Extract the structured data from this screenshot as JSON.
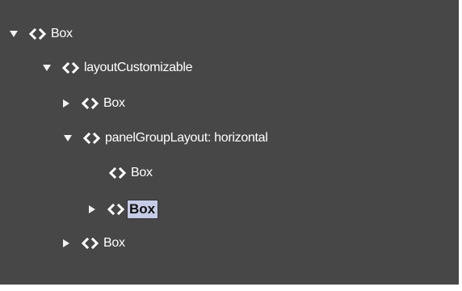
{
  "tree": {
    "nodes": [
      {
        "label": "Box",
        "toggle": "expanded",
        "icon": "tag-icon"
      },
      {
        "label": "layoutCustomizable",
        "toggle": "expanded",
        "icon": "tag-icon"
      },
      {
        "label": "Box",
        "toggle": "collapsed",
        "icon": "tag-icon"
      },
      {
        "label": "panelGroupLayout: horizontal",
        "toggle": "expanded",
        "icon": "tag-icon"
      },
      {
        "label": "Box",
        "toggle": "none",
        "icon": "tag-icon"
      },
      {
        "label": "Box",
        "toggle": "collapsed",
        "icon": "tag-icon",
        "selected": true
      },
      {
        "label": "Box",
        "toggle": "collapsed",
        "icon": "tag-icon"
      }
    ]
  },
  "colors": {
    "panel_background": "#474747",
    "text": "#ffffff",
    "selection_background": "#c6cce6",
    "selection_text": "#111111"
  }
}
